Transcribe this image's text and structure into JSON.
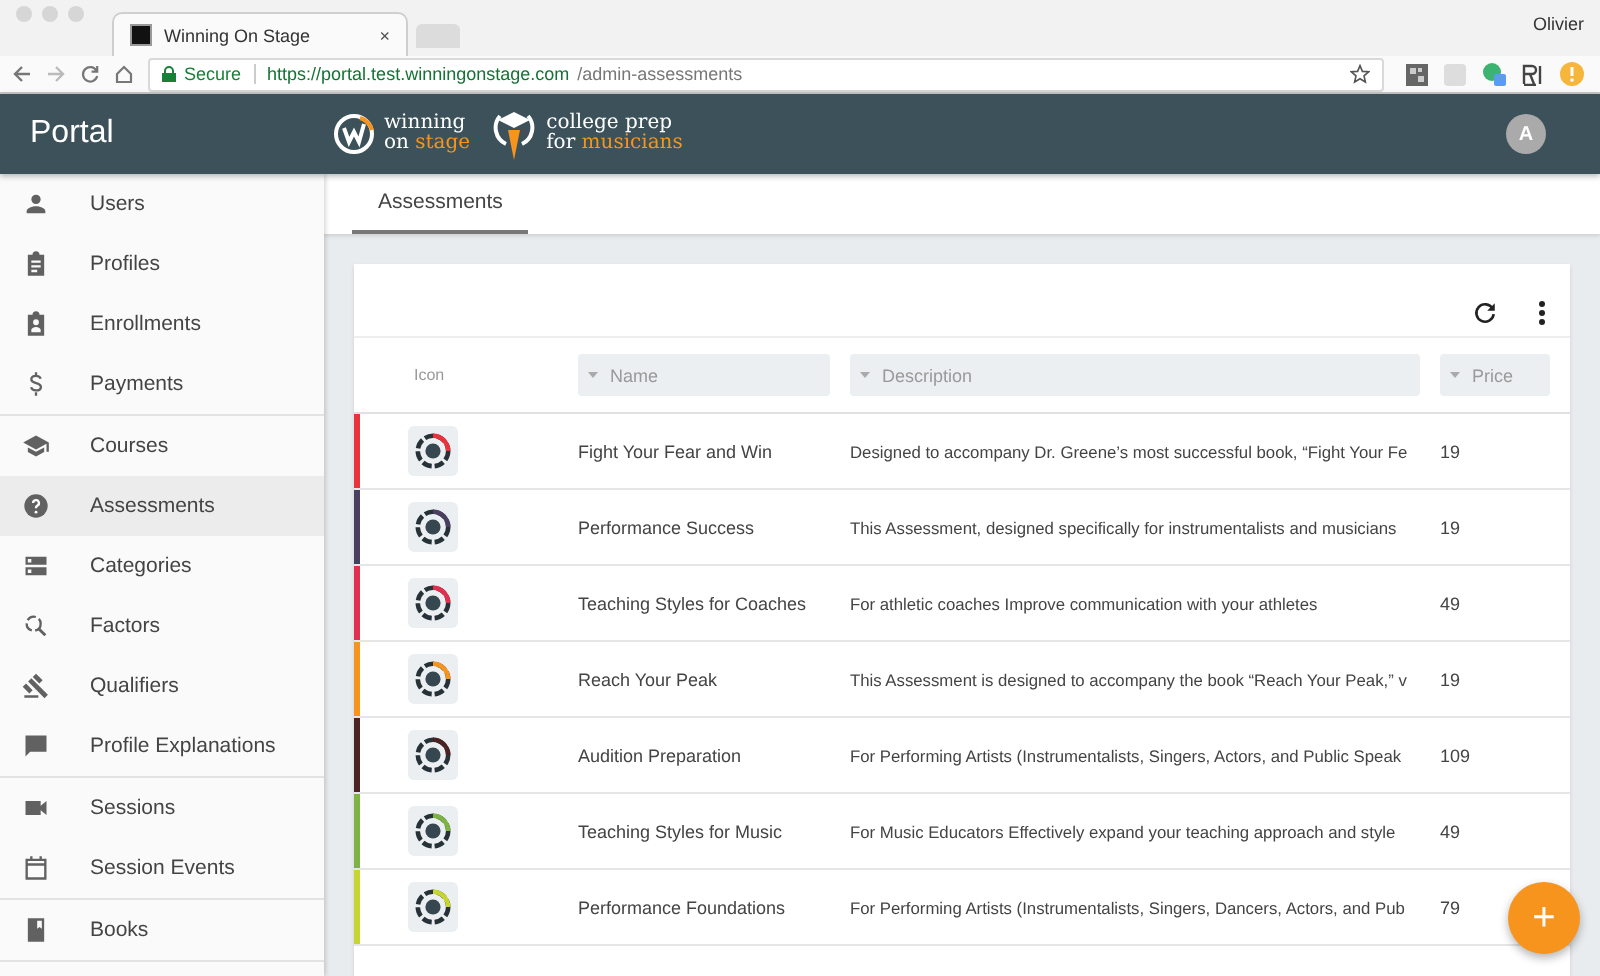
{
  "browser": {
    "tab": {
      "title": "Winning On Stage",
      "close": "×"
    },
    "profile": "Olivier",
    "address": {
      "security": "Secure",
      "origin": "https://portal.test.winningonstage.com",
      "path": "/admin-assessments"
    }
  },
  "header": {
    "title": "Portal",
    "logos": [
      {
        "lines": [
          [
            {
              "text": "winning",
              "accent": false
            }
          ],
          [
            {
              "text": "on",
              "accent": false
            },
            {
              "text": "stage",
              "accent": true
            }
          ]
        ]
      },
      {
        "lines": [
          [
            {
              "text": "college prep",
              "accent": false
            }
          ],
          [
            {
              "text": "for",
              "accent": false
            },
            {
              "text": "musicians",
              "accent": true
            }
          ]
        ]
      }
    ],
    "avatar": "A"
  },
  "sidebar": {
    "sections": [
      {
        "items": [
          {
            "label": "Users",
            "selected": false
          },
          {
            "label": "Profiles",
            "selected": false
          },
          {
            "label": "Enrollments",
            "selected": false
          },
          {
            "label": "Payments",
            "selected": false
          }
        ]
      },
      {
        "items": [
          {
            "label": "Courses",
            "selected": false
          },
          {
            "label": "Assessments",
            "selected": true
          },
          {
            "label": "Categories",
            "selected": false
          },
          {
            "label": "Factors",
            "selected": false
          },
          {
            "label": "Qualifiers",
            "selected": false
          },
          {
            "label": "Profile Explanations",
            "selected": false
          }
        ]
      },
      {
        "items": [
          {
            "label": "Sessions",
            "selected": false
          },
          {
            "label": "Session Events",
            "selected": false
          }
        ]
      },
      {
        "items": [
          {
            "label": "Books",
            "selected": false
          }
        ]
      }
    ]
  },
  "tabs": [
    {
      "label": "Assessments",
      "selected": true
    }
  ],
  "table": {
    "columns": [
      {
        "label": "Icon",
        "kind": "plain"
      },
      {
        "label": "Name",
        "kind": "filter"
      },
      {
        "label": "Description",
        "kind": "filter"
      },
      {
        "label": "Price",
        "kind": "filter"
      }
    ],
    "rows": [
      {
        "color": "#e8323c",
        "name": "Fight Your Fear and Win",
        "description": "Designed to accompany Dr. Greene’s most successful book, “Fight Your Fe",
        "price": "19"
      },
      {
        "color": "#4b3f61",
        "name": "Performance Success",
        "description": "This Assessment, designed specifically for instrumentalists and musicians",
        "price": "19"
      },
      {
        "color": "#e0304e",
        "name": "Teaching Styles for Coaches",
        "description": "For athletic coaches Improve communication with your athletes",
        "price": "49"
      },
      {
        "color": "#f7941d",
        "name": "Reach Your Peak",
        "description": "This Assessment is designed to accompany the book “Reach Your Peak,” v",
        "price": "19"
      },
      {
        "color": "#4a2222",
        "name": "Audition Preparation",
        "description": "For Performing Artists (Instrumentalists, Singers, Actors, and Public Speak",
        "price": "109"
      },
      {
        "color": "#7cb342",
        "name": "Teaching Styles for Music",
        "description": "For Music Educators   Effectively expand your teaching approach and style",
        "price": "49"
      },
      {
        "color": "#c6d52f",
        "name": "Performance Foundations",
        "description": "For Performing Artists (Instrumentalists, Singers, Dancers, Actors, and Pub",
        "price": "79"
      }
    ]
  },
  "fab": "+"
}
